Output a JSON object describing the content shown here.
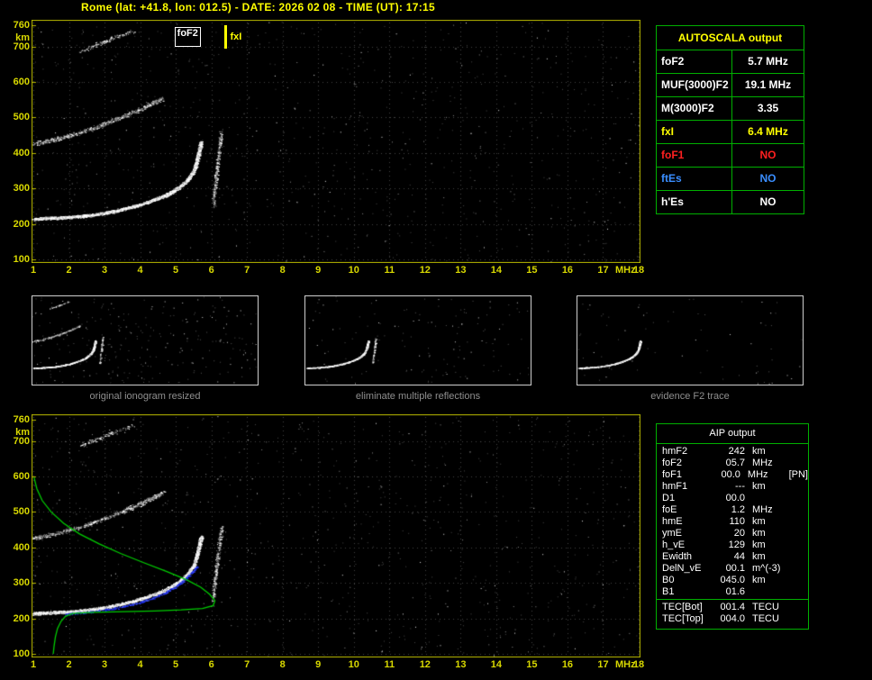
{
  "title": "Rome (lat: +41.8, lon: 012.5) - DATE: 2026 02 08 - TIME (UT): 17:15",
  "colors": {
    "title": "#ffff00",
    "axis_labels": "#d8d800",
    "plot_border": "#b9b900",
    "grid": "#434343",
    "trace": "#ffffff",
    "profile_line": "#00cc00",
    "restored_trace": "#2a3cff",
    "panel_border": "#00b000",
    "caption": "#8f8f8f"
  },
  "autoscala": {
    "header": "AUTOSCALA output",
    "rows": [
      {
        "label": "foF2",
        "value": "5.7 MHz",
        "color": "#ffffff"
      },
      {
        "label": "MUF(3000)F2",
        "value": "19.1 MHz",
        "color": "#ffffff"
      },
      {
        "label": "M(3000)F2",
        "value": "3.35",
        "color": "#ffffff"
      },
      {
        "label": "fxI",
        "value": "6.4 MHz",
        "color": "#ffff00"
      },
      {
        "label": "foF1",
        "value": "NO",
        "color": "#ff2020"
      },
      {
        "label": "ftEs",
        "value": "NO",
        "color": "#3a8eff"
      },
      {
        "label": "h'Es",
        "value": "NO",
        "color": "#ffffff"
      }
    ]
  },
  "aip": {
    "header": "AIP output",
    "rows": [
      {
        "label": "hmF2",
        "value": "242",
        "unit": "km",
        "extra": ""
      },
      {
        "label": "foF2",
        "value": "05.7",
        "unit": "MHz",
        "extra": ""
      },
      {
        "label": "foF1",
        "value": "00.0",
        "unit": "MHz",
        "extra": "[PN]"
      },
      {
        "label": "hmF1",
        "value": "---",
        "unit": "km",
        "extra": ""
      },
      {
        "label": "D1",
        "value": "00.0",
        "unit": "",
        "extra": ""
      },
      {
        "label": "foE",
        "value": "1.2",
        "unit": "MHz",
        "extra": ""
      },
      {
        "label": "hmE",
        "value": "110",
        "unit": "km",
        "extra": ""
      },
      {
        "label": "ymE",
        "value": "20",
        "unit": "km",
        "extra": ""
      },
      {
        "label": "h_vE",
        "value": "129",
        "unit": "km",
        "extra": ""
      },
      {
        "label": "Ewidth",
        "value": "44",
        "unit": "km",
        "extra": ""
      },
      {
        "label": "DelN_vE",
        "value": "00.1",
        "unit": "m^(-3)",
        "extra": ""
      },
      {
        "label": "B0",
        "value": "045.0",
        "unit": "km",
        "extra": ""
      },
      {
        "label": "B1",
        "value": "01.6",
        "unit": "",
        "extra": ""
      }
    ],
    "tec_rows": [
      {
        "label": "TEC[Bot]",
        "value": "001.4",
        "unit": "TECU",
        "extra": ""
      },
      {
        "label": "TEC[Top]",
        "value": "004.0",
        "unit": "TECU",
        "extra": ""
      }
    ]
  },
  "thumbnails": [
    {
      "caption": "original ionogram resized",
      "series": [
        "F2-trace",
        "second-hop-trace",
        "multiple-reflection-specks",
        "x-mode-spread"
      ]
    },
    {
      "caption": "eliminate multiple reflections",
      "series": [
        "F2-trace",
        "x-mode-spread"
      ]
    },
    {
      "caption": "evidence F2 trace",
      "series": [
        "F2-trace"
      ]
    }
  ],
  "chart_data": [
    {
      "name": "top-ionogram",
      "type": "scatter",
      "xlabel": "MHz",
      "ylabel": "km",
      "xlim": [
        1,
        18
      ],
      "ylim": [
        90,
        775
      ],
      "x_ticks": [
        1,
        2,
        3,
        4,
        5,
        6,
        7,
        8,
        9,
        10,
        11,
        12,
        13,
        14,
        15,
        16,
        17,
        18
      ],
      "y_ticks": [
        100,
        200,
        300,
        400,
        500,
        600,
        700,
        760
      ],
      "grid": true,
      "markers": [
        {
          "label": "foF2",
          "freq_mhz": 5.7,
          "color": "#ffffff",
          "style": "boxed"
        },
        {
          "label": "fxI",
          "freq_mhz": 6.4,
          "color": "#ffff00",
          "style": "bar"
        }
      ],
      "series": [
        {
          "name": "F2-trace",
          "points": [
            [
              1.0,
              214
            ],
            [
              1.4,
              216
            ],
            [
              1.8,
              218
            ],
            [
              2.2,
              221
            ],
            [
              2.6,
              225
            ],
            [
              3.0,
              231
            ],
            [
              3.4,
              239
            ],
            [
              3.8,
              249
            ],
            [
              4.2,
              261
            ],
            [
              4.6,
              276
            ],
            [
              4.9,
              291
            ],
            [
              5.15,
              308
            ],
            [
              5.35,
              327
            ],
            [
              5.5,
              350
            ],
            [
              5.58,
              375
            ],
            [
              5.64,
              400
            ],
            [
              5.68,
              418
            ],
            [
              5.7,
              430
            ]
          ]
        },
        {
          "name": "second-hop-trace",
          "points": [
            [
              1.0,
              426
            ],
            [
              1.4,
              434
            ],
            [
              1.9,
              446
            ],
            [
              2.4,
              461
            ],
            [
              2.9,
              478
            ],
            [
              3.4,
              498
            ],
            [
              3.9,
              519
            ],
            [
              4.3,
              538
            ],
            [
              4.6,
              553
            ]
          ]
        },
        {
          "name": "multiple-reflection-specks",
          "points": [
            [
              2.3,
              686
            ],
            [
              2.6,
              698
            ],
            [
              2.9,
              710
            ],
            [
              3.2,
              722
            ],
            [
              3.5,
              734
            ],
            [
              3.8,
              745
            ]
          ]
        },
        {
          "name": "x-mode-spread",
          "points": [
            [
              6.05,
              255
            ],
            [
              6.08,
              290
            ],
            [
              6.12,
              325
            ],
            [
              6.16,
              360
            ],
            [
              6.2,
              395
            ],
            [
              6.24,
              428
            ],
            [
              6.28,
              455
            ]
          ]
        }
      ]
    },
    {
      "name": "bottom-ionogram-with-profile",
      "type": "scatter",
      "xlabel": "MHz",
      "ylabel": "km",
      "xlim": [
        1,
        18
      ],
      "ylim": [
        90,
        775
      ],
      "x_ticks": [
        1,
        2,
        3,
        4,
        5,
        6,
        7,
        8,
        9,
        10,
        11,
        12,
        13,
        14,
        15,
        16,
        17,
        18
      ],
      "y_ticks": [
        100,
        200,
        300,
        400,
        500,
        600,
        700,
        760
      ],
      "grid": true,
      "markers": [],
      "series": [
        {
          "name": "F2-trace",
          "points": [
            [
              1.0,
              214
            ],
            [
              1.4,
              216
            ],
            [
              1.8,
              218
            ],
            [
              2.2,
              221
            ],
            [
              2.6,
              225
            ],
            [
              3.0,
              231
            ],
            [
              3.4,
              239
            ],
            [
              3.8,
              249
            ],
            [
              4.2,
              261
            ],
            [
              4.6,
              276
            ],
            [
              4.9,
              291
            ],
            [
              5.15,
              308
            ],
            [
              5.35,
              327
            ],
            [
              5.5,
              350
            ],
            [
              5.58,
              375
            ],
            [
              5.64,
              400
            ],
            [
              5.68,
              418
            ],
            [
              5.7,
              430
            ]
          ]
        },
        {
          "name": "second-hop-trace",
          "points": [
            [
              1.0,
              426
            ],
            [
              1.4,
              434
            ],
            [
              1.9,
              446
            ],
            [
              2.4,
              461
            ],
            [
              2.9,
              478
            ],
            [
              3.4,
              498
            ],
            [
              3.9,
              519
            ],
            [
              4.3,
              538
            ],
            [
              4.6,
              553
            ]
          ]
        },
        {
          "name": "multiple-reflection-specks",
          "points": [
            [
              2.3,
              686
            ],
            [
              2.6,
              698
            ],
            [
              2.9,
              710
            ],
            [
              3.2,
              722
            ],
            [
              3.5,
              734
            ],
            [
              3.8,
              745
            ]
          ]
        },
        {
          "name": "x-mode-spread",
          "points": [
            [
              6.05,
              255
            ],
            [
              6.08,
              290
            ],
            [
              6.12,
              325
            ],
            [
              6.16,
              360
            ],
            [
              6.2,
              395
            ],
            [
              6.24,
              428
            ],
            [
              6.28,
              455
            ]
          ]
        },
        {
          "name": "restored-trace-blue",
          "color": "#2a3cff",
          "points": [
            [
              1.9,
              212
            ],
            [
              2.3,
              216
            ],
            [
              2.8,
              221
            ],
            [
              3.3,
              229
            ],
            [
              3.8,
              240
            ],
            [
              4.3,
              255
            ],
            [
              4.7,
              272
            ],
            [
              5.0,
              290
            ],
            [
              5.25,
              310
            ],
            [
              5.45,
              330
            ],
            [
              5.6,
              348
            ]
          ]
        },
        {
          "name": "electron-density-profile",
          "color": "#00cc00",
          "points": [
            [
              1.02,
              597
            ],
            [
              1.1,
              565
            ],
            [
              1.25,
              532
            ],
            [
              1.5,
              500
            ],
            [
              1.85,
              468
            ],
            [
              2.3,
              438
            ],
            [
              2.85,
              410
            ],
            [
              3.45,
              383
            ],
            [
              4.1,
              357
            ],
            [
              4.75,
              332
            ],
            [
              5.3,
              309
            ],
            [
              5.7,
              288
            ],
            [
              5.95,
              268
            ],
            [
              6.1,
              250
            ],
            [
              6.05,
              236
            ],
            [
              5.75,
              228
            ],
            [
              5.15,
              224
            ],
            [
              4.4,
              221
            ],
            [
              3.5,
              219
            ],
            [
              2.7,
              217
            ],
            [
              2.1,
              214
            ],
            [
              1.9,
              206
            ],
            [
              1.78,
              192
            ],
            [
              1.68,
              172
            ],
            [
              1.62,
              148
            ],
            [
              1.58,
              120
            ],
            [
              1.56,
              100
            ]
          ]
        }
      ]
    }
  ]
}
